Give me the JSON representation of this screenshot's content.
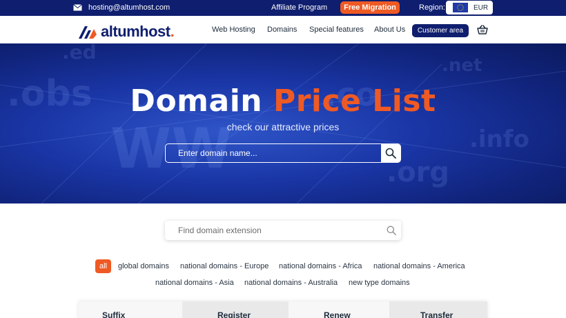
{
  "topbar": {
    "email": "hosting@altumhost.com",
    "affiliate": "Affiliate Program",
    "free_migration": "Free Migration",
    "region_label": "Region:",
    "currency": "EUR"
  },
  "header": {
    "logo_text": "altumhost",
    "logo_dot": ".",
    "nav": [
      "Web Hosting",
      "Domains",
      "Special features",
      "About Us"
    ],
    "customer_area": "Customer area"
  },
  "hero": {
    "title_main": "Domain",
    "title_accent": "Price List",
    "subtitle": "check our attractive prices",
    "search_placeholder": "Enter domain name..."
  },
  "extension_search": {
    "placeholder": "Find domain extension"
  },
  "filters": [
    "all",
    "global domains",
    "national domains - Europe",
    "national domains - Africa",
    "national domains - America",
    "national domains - Asia",
    "national domains - Australia",
    "new type domains"
  ],
  "table": {
    "columns": [
      "Suffix",
      "Register",
      "Renew",
      "Transfer"
    ]
  },
  "colors": {
    "navy": "#0f1e6e",
    "accent": "#ef5a24"
  }
}
